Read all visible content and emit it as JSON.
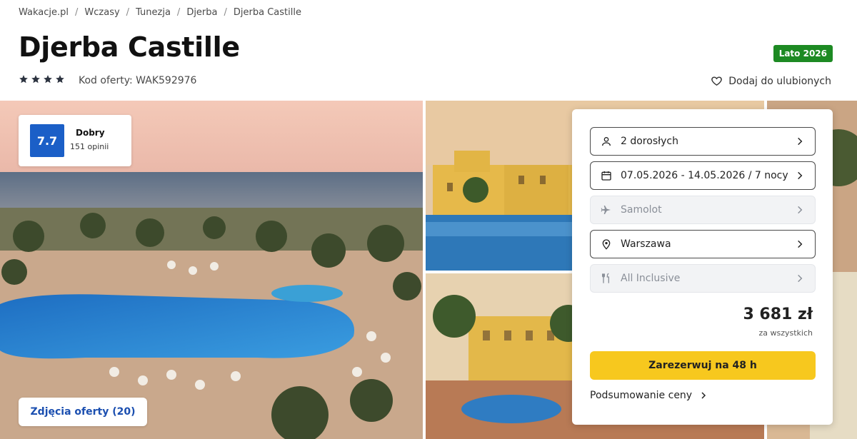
{
  "breadcrumb": [
    "Wakacje.pl",
    "Wczasy",
    "Tunezja",
    "Djerba",
    "Djerba Castille"
  ],
  "hotel": {
    "name": "Djerba Castille",
    "stars": 4,
    "offer_code": "Kod oferty: WAK592976",
    "season_badge": "Lato 2026",
    "favorite_label": "Dodaj do ulubionych"
  },
  "rating": {
    "score": "7.7",
    "label": "Dobry",
    "reviews": "151 opinii"
  },
  "gallery": {
    "photos_button": "Zdjęcia oferty (20)"
  },
  "booking": {
    "travelers": "2 dorosłych",
    "dates": "07.05.2026 - 14.05.2026 / 7 nocy",
    "transport": "Samolot",
    "departure": "Warszawa",
    "board": "All Inclusive",
    "price": "3 681 zł",
    "price_note": "za wszystkich",
    "reserve_button": "Zarezerwuj na 48 h",
    "summary_link": "Podsumowanie ceny"
  },
  "colors": {
    "accent_blue": "#1b5fc7",
    "badge_green": "#1d8a23",
    "cta_yellow": "#f7c81e"
  },
  "icons": [
    "star-icon",
    "heart-icon",
    "person-icon",
    "calendar-icon",
    "plane-icon",
    "location-pin-icon",
    "cutlery-icon",
    "chevron-right-icon"
  ]
}
